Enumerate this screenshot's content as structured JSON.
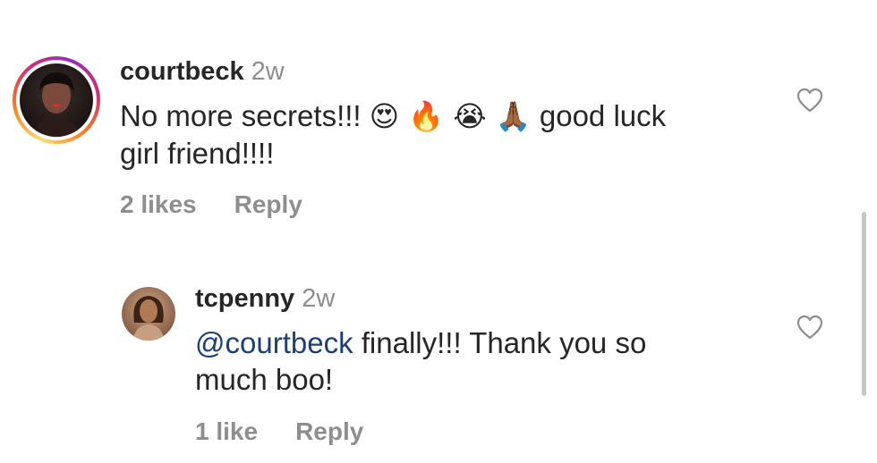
{
  "comments": [
    {
      "username": "courtbeck",
      "time": "2w",
      "text_part1": "No more secrets!!!",
      "emojis": "😍 🔥 😭 🙏🏾",
      "text_part2": "good luck",
      "text_line2": "girl friend!!!!",
      "likes": "2 likes",
      "reply_label": "Reply",
      "like_icon": "heart-outline-icon"
    },
    {
      "username": "tcpenny",
      "time": "2w",
      "mention": "@courtbeck",
      "text_part1": "finally!!! Thank you so",
      "text_line2": "much boo!",
      "likes": "1 like",
      "reply_label": "Reply",
      "like_icon": "heart-outline-icon"
    }
  ],
  "colors": {
    "mention": "#1c3f7a",
    "muted": "#8e8e8e",
    "text": "#262626"
  }
}
